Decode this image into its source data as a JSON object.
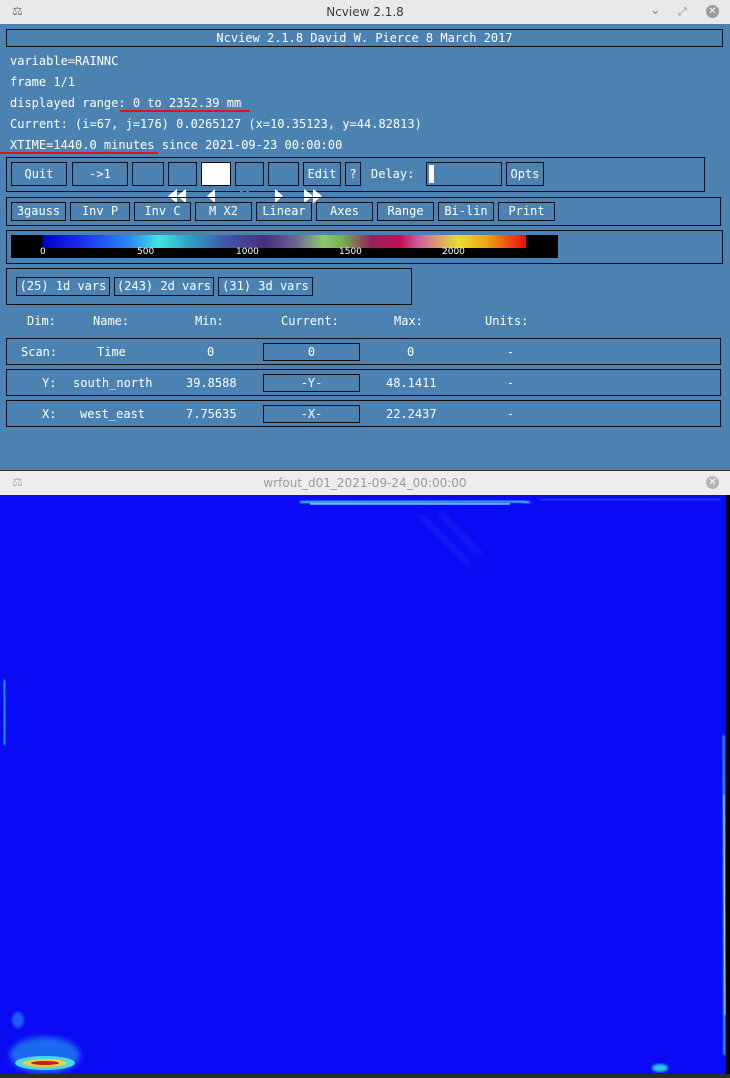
{
  "window1": {
    "title": "Ncview 2.1.8"
  },
  "window2": {
    "title": "wrfout_d01_2021-09-24_00:00:00"
  },
  "banner": "Ncview 2.1.8 David W. Pierce  8 March 2017",
  "info": {
    "variable": "variable=RAINNC",
    "frame": "frame 1/1",
    "range_label": "displayed range:",
    "range_value": " 0 to 2352.39 mm",
    "current": "Current: (i=67, j=176) 0.0265127 (x=10.35123, y=44.82813)",
    "time_label": "XTIME=1440.0 minutes",
    "time_rest": " since 2021-09-23 00:00:00"
  },
  "controls": {
    "quit": "Quit",
    "to_first": "->1",
    "edit": "Edit",
    "help": "?",
    "delay": "Delay:",
    "opts": "Opts"
  },
  "options": [
    "3gauss",
    "Inv P",
    "Inv C",
    "M X2",
    "Linear",
    "Axes",
    "Range",
    "Bi-lin",
    "Print"
  ],
  "colorbar": {
    "ticks": [
      "0",
      "500",
      "1000",
      "1500",
      "2000"
    ]
  },
  "var_groups": [
    "(25) 1d vars",
    "(243) 2d vars",
    "(31) 3d vars"
  ],
  "dims": {
    "headers": [
      "Dim:",
      "Name:",
      "Min:",
      "Current:",
      "Max:",
      "Units:"
    ],
    "rows": [
      {
        "dim": "Scan:",
        "name": "Time",
        "min": "0",
        "current": "0",
        "max": "0",
        "units": "-"
      },
      {
        "dim": "Y:",
        "name": "south_north",
        "min": "39.8588",
        "current": "-Y-",
        "max": "48.1411",
        "units": "-"
      },
      {
        "dim": "X:",
        "name": "west_east",
        "min": "7.75635",
        "current": "-X-",
        "max": "22.2437",
        "units": "-"
      }
    ]
  },
  "colors": {
    "panel": "#4c82b2",
    "plot_background": "#0a0af4",
    "annotation": "#e0121b"
  }
}
